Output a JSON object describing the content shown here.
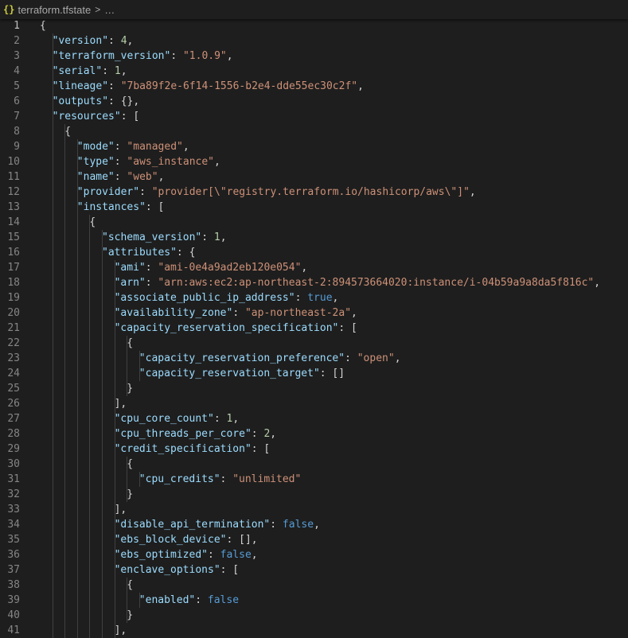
{
  "breadcrumb": {
    "icon_text": "{}",
    "file_name": "terraform.tfstate",
    "separator": ">",
    "more": "…"
  },
  "editor": {
    "active_line": 1,
    "lines": [
      {
        "n": "1",
        "indent": 0,
        "t": [
          [
            "p",
            "{"
          ]
        ]
      },
      {
        "n": "2",
        "indent": 1,
        "t": [
          [
            "k",
            "\"version\""
          ],
          [
            "p",
            ": "
          ],
          [
            "n",
            "4"
          ],
          [
            "p",
            ","
          ]
        ]
      },
      {
        "n": "3",
        "indent": 1,
        "t": [
          [
            "k",
            "\"terraform_version\""
          ],
          [
            "p",
            ": "
          ],
          [
            "s",
            "\"1.0.9\""
          ],
          [
            "p",
            ","
          ]
        ]
      },
      {
        "n": "4",
        "indent": 1,
        "t": [
          [
            "k",
            "\"serial\""
          ],
          [
            "p",
            ": "
          ],
          [
            "n",
            "1"
          ],
          [
            "p",
            ","
          ]
        ]
      },
      {
        "n": "5",
        "indent": 1,
        "t": [
          [
            "k",
            "\"lineage\""
          ],
          [
            "p",
            ": "
          ],
          [
            "s",
            "\"7ba89f2e-6f14-1556-b2e4-dde55ec30c2f\""
          ],
          [
            "p",
            ","
          ]
        ]
      },
      {
        "n": "6",
        "indent": 1,
        "t": [
          [
            "k",
            "\"outputs\""
          ],
          [
            "p",
            ": {},"
          ]
        ]
      },
      {
        "n": "7",
        "indent": 1,
        "t": [
          [
            "k",
            "\"resources\""
          ],
          [
            "p",
            ": ["
          ]
        ]
      },
      {
        "n": "8",
        "indent": 2,
        "t": [
          [
            "p",
            "{"
          ]
        ]
      },
      {
        "n": "9",
        "indent": 3,
        "t": [
          [
            "k",
            "\"mode\""
          ],
          [
            "p",
            ": "
          ],
          [
            "s",
            "\"managed\""
          ],
          [
            "p",
            ","
          ]
        ]
      },
      {
        "n": "10",
        "indent": 3,
        "t": [
          [
            "k",
            "\"type\""
          ],
          [
            "p",
            ": "
          ],
          [
            "s",
            "\"aws_instance\""
          ],
          [
            "p",
            ","
          ]
        ]
      },
      {
        "n": "11",
        "indent": 3,
        "t": [
          [
            "k",
            "\"name\""
          ],
          [
            "p",
            ": "
          ],
          [
            "s",
            "\"web\""
          ],
          [
            "p",
            ","
          ]
        ]
      },
      {
        "n": "12",
        "indent": 3,
        "t": [
          [
            "k",
            "\"provider\""
          ],
          [
            "p",
            ": "
          ],
          [
            "s",
            "\"provider[\\\"registry.terraform.io/hashicorp/aws\\\"]\""
          ],
          [
            "p",
            ","
          ]
        ]
      },
      {
        "n": "13",
        "indent": 3,
        "t": [
          [
            "k",
            "\"instances\""
          ],
          [
            "p",
            ": ["
          ]
        ]
      },
      {
        "n": "14",
        "indent": 4,
        "t": [
          [
            "p",
            "{"
          ]
        ]
      },
      {
        "n": "15",
        "indent": 5,
        "t": [
          [
            "k",
            "\"schema_version\""
          ],
          [
            "p",
            ": "
          ],
          [
            "n",
            "1"
          ],
          [
            "p",
            ","
          ]
        ]
      },
      {
        "n": "16",
        "indent": 5,
        "t": [
          [
            "k",
            "\"attributes\""
          ],
          [
            "p",
            ": {"
          ]
        ]
      },
      {
        "n": "17",
        "indent": 6,
        "t": [
          [
            "k",
            "\"ami\""
          ],
          [
            "p",
            ": "
          ],
          [
            "s",
            "\"ami-0e4a9ad2eb120e054\""
          ],
          [
            "p",
            ","
          ]
        ]
      },
      {
        "n": "18",
        "indent": 6,
        "t": [
          [
            "k",
            "\"arn\""
          ],
          [
            "p",
            ": "
          ],
          [
            "s",
            "\"arn:aws:ec2:ap-northeast-2:894573664020:instance/i-04b59a9a8da5f816c\""
          ],
          [
            "p",
            ","
          ]
        ]
      },
      {
        "n": "19",
        "indent": 6,
        "t": [
          [
            "k",
            "\"associate_public_ip_address\""
          ],
          [
            "p",
            ": "
          ],
          [
            "b",
            "true"
          ],
          [
            "p",
            ","
          ]
        ]
      },
      {
        "n": "20",
        "indent": 6,
        "t": [
          [
            "k",
            "\"availability_zone\""
          ],
          [
            "p",
            ": "
          ],
          [
            "s",
            "\"ap-northeast-2a\""
          ],
          [
            "p",
            ","
          ]
        ]
      },
      {
        "n": "21",
        "indent": 6,
        "t": [
          [
            "k",
            "\"capacity_reservation_specification\""
          ],
          [
            "p",
            ": ["
          ]
        ]
      },
      {
        "n": "22",
        "indent": 7,
        "t": [
          [
            "p",
            "{"
          ]
        ]
      },
      {
        "n": "23",
        "indent": 8,
        "t": [
          [
            "k",
            "\"capacity_reservation_preference\""
          ],
          [
            "p",
            ": "
          ],
          [
            "s",
            "\"open\""
          ],
          [
            "p",
            ","
          ]
        ]
      },
      {
        "n": "24",
        "indent": 8,
        "t": [
          [
            "k",
            "\"capacity_reservation_target\""
          ],
          [
            "p",
            ": []"
          ]
        ]
      },
      {
        "n": "25",
        "indent": 7,
        "t": [
          [
            "p",
            "}"
          ]
        ]
      },
      {
        "n": "26",
        "indent": 6,
        "t": [
          [
            "p",
            "],"
          ]
        ]
      },
      {
        "n": "27",
        "indent": 6,
        "t": [
          [
            "k",
            "\"cpu_core_count\""
          ],
          [
            "p",
            ": "
          ],
          [
            "n",
            "1"
          ],
          [
            "p",
            ","
          ]
        ]
      },
      {
        "n": "28",
        "indent": 6,
        "t": [
          [
            "k",
            "\"cpu_threads_per_core\""
          ],
          [
            "p",
            ": "
          ],
          [
            "n",
            "2"
          ],
          [
            "p",
            ","
          ]
        ]
      },
      {
        "n": "29",
        "indent": 6,
        "t": [
          [
            "k",
            "\"credit_specification\""
          ],
          [
            "p",
            ": ["
          ]
        ]
      },
      {
        "n": "30",
        "indent": 7,
        "t": [
          [
            "p",
            "{"
          ]
        ]
      },
      {
        "n": "31",
        "indent": 8,
        "t": [
          [
            "k",
            "\"cpu_credits\""
          ],
          [
            "p",
            ": "
          ],
          [
            "s",
            "\"unlimited\""
          ]
        ]
      },
      {
        "n": "32",
        "indent": 7,
        "t": [
          [
            "p",
            "}"
          ]
        ]
      },
      {
        "n": "33",
        "indent": 6,
        "t": [
          [
            "p",
            "],"
          ]
        ]
      },
      {
        "n": "34",
        "indent": 6,
        "t": [
          [
            "k",
            "\"disable_api_termination\""
          ],
          [
            "p",
            ": "
          ],
          [
            "b",
            "false"
          ],
          [
            "p",
            ","
          ]
        ]
      },
      {
        "n": "35",
        "indent": 6,
        "t": [
          [
            "k",
            "\"ebs_block_device\""
          ],
          [
            "p",
            ": [],"
          ]
        ]
      },
      {
        "n": "36",
        "indent": 6,
        "t": [
          [
            "k",
            "\"ebs_optimized\""
          ],
          [
            "p",
            ": "
          ],
          [
            "b",
            "false"
          ],
          [
            "p",
            ","
          ]
        ]
      },
      {
        "n": "37",
        "indent": 6,
        "t": [
          [
            "k",
            "\"enclave_options\""
          ],
          [
            "p",
            ": ["
          ]
        ]
      },
      {
        "n": "38",
        "indent": 7,
        "t": [
          [
            "p",
            "{"
          ]
        ]
      },
      {
        "n": "39",
        "indent": 8,
        "t": [
          [
            "k",
            "\"enabled\""
          ],
          [
            "p",
            ": "
          ],
          [
            "b",
            "false"
          ]
        ]
      },
      {
        "n": "40",
        "indent": 7,
        "t": [
          [
            "p",
            "}"
          ]
        ]
      },
      {
        "n": "41",
        "indent": 6,
        "t": [
          [
            "p",
            "],"
          ]
        ]
      }
    ]
  }
}
